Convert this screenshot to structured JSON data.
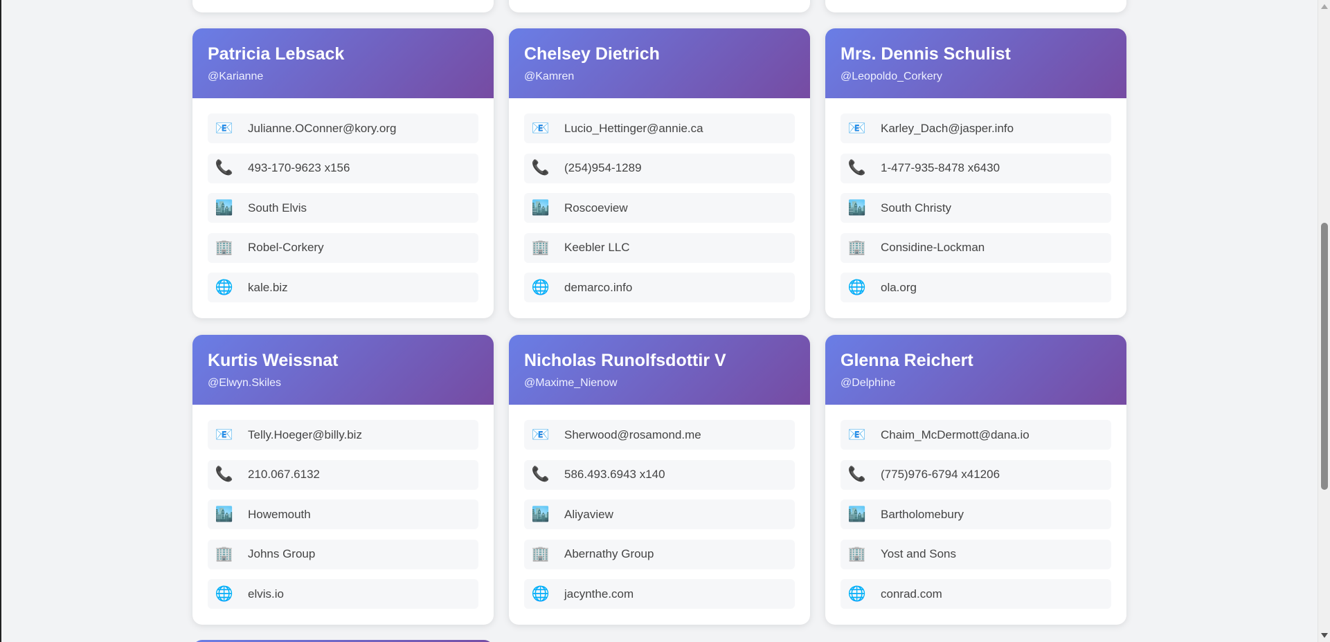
{
  "icons": {
    "email": "📧",
    "phone": "📞",
    "city": "🏙️",
    "company": "🏢",
    "website": "🌐"
  },
  "cards": [
    {
      "name": "Patricia Lebsack",
      "username": "@Karianne",
      "email": "Julianne.OConner@kory.org",
      "phone": "493-170-9623 x156",
      "city": "South Elvis",
      "company": "Robel-Corkery",
      "website": "kale.biz"
    },
    {
      "name": "Chelsey Dietrich",
      "username": "@Kamren",
      "email": "Lucio_Hettinger@annie.ca",
      "phone": "(254)954-1289",
      "city": "Roscoeview",
      "company": "Keebler LLC",
      "website": "demarco.info"
    },
    {
      "name": "Mrs. Dennis Schulist",
      "username": "@Leopoldo_Corkery",
      "email": "Karley_Dach@jasper.info",
      "phone": "1-477-935-8478 x6430",
      "city": "South Christy",
      "company": "Considine-Lockman",
      "website": "ola.org"
    },
    {
      "name": "Kurtis Weissnat",
      "username": "@Elwyn.Skiles",
      "email": "Telly.Hoeger@billy.biz",
      "phone": "210.067.6132",
      "city": "Howemouth",
      "company": "Johns Group",
      "website": "elvis.io"
    },
    {
      "name": "Nicholas Runolfsdottir V",
      "username": "@Maxime_Nienow",
      "email": "Sherwood@rosamond.me",
      "phone": "586.493.6943 x140",
      "city": "Aliyaview",
      "company": "Abernathy Group",
      "website": "jacynthe.com"
    },
    {
      "name": "Glenna Reichert",
      "username": "@Delphine",
      "email": "Chaim_McDermott@dana.io",
      "phone": "(775)976-6794 x41206",
      "city": "Bartholomebury",
      "company": "Yost and Sons",
      "website": "conrad.com"
    }
  ]
}
